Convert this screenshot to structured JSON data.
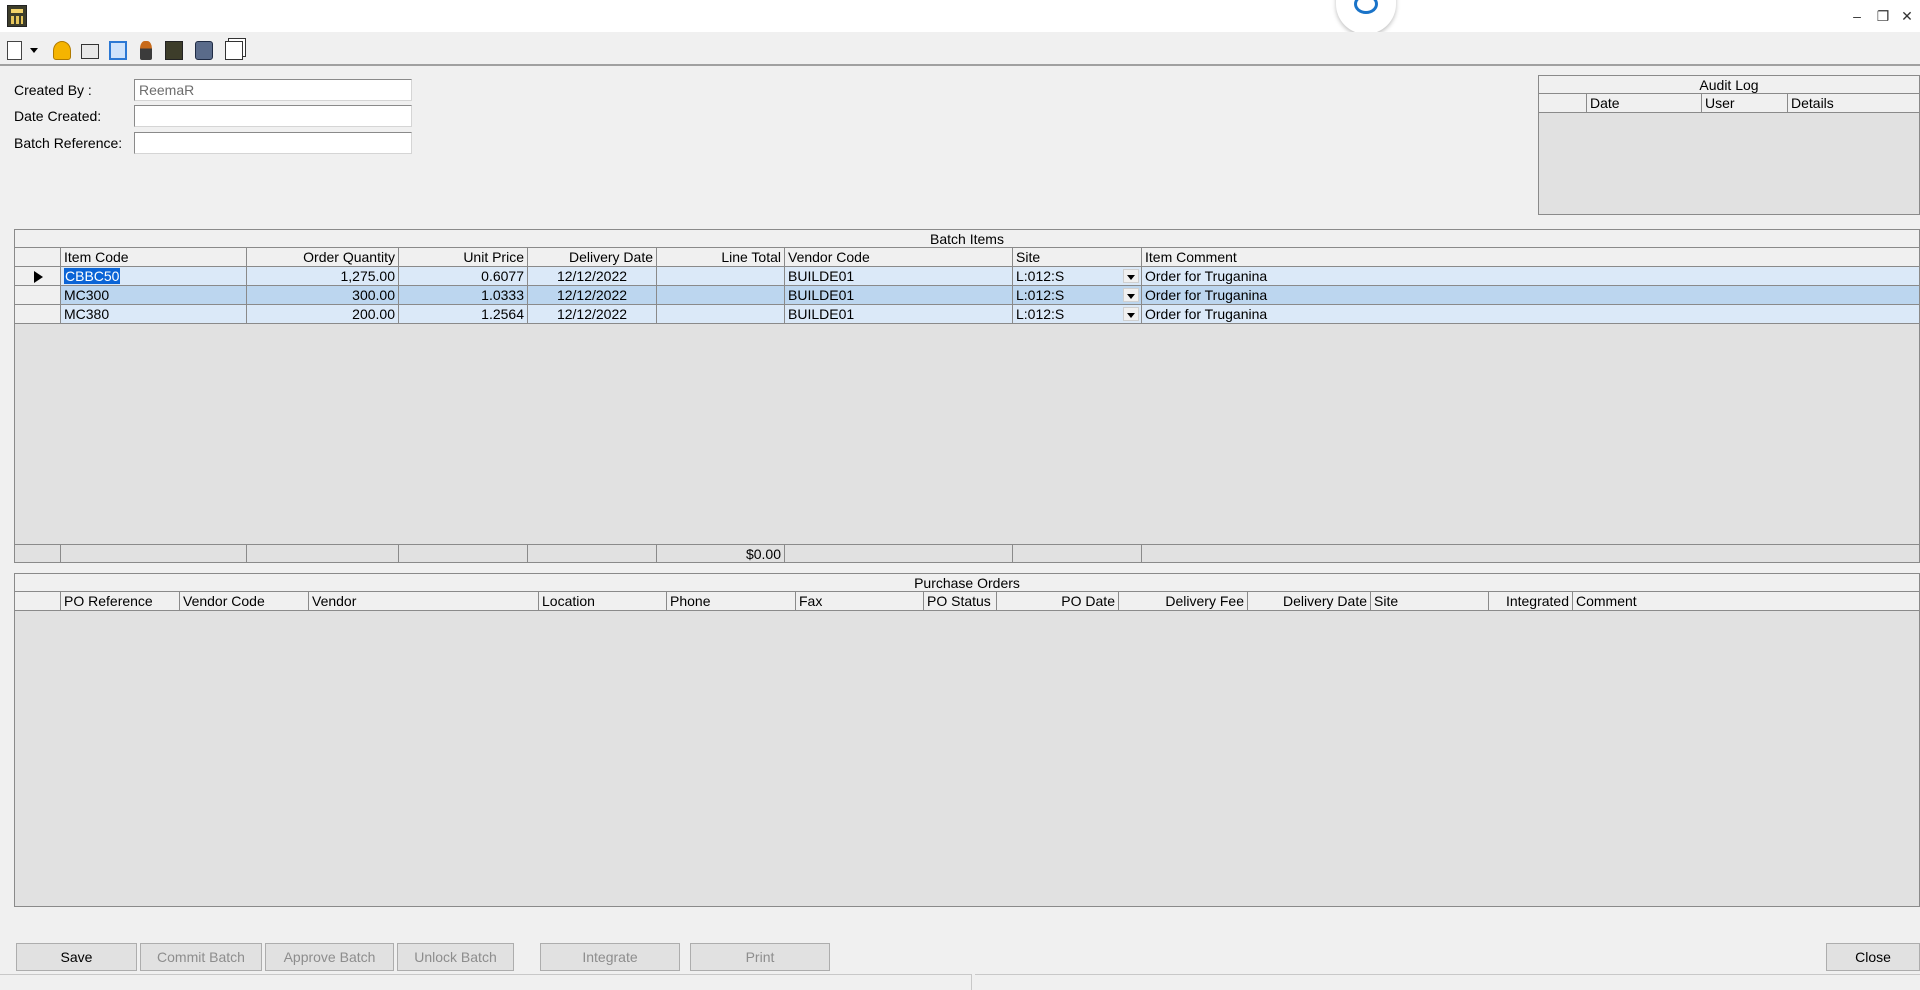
{
  "window": {
    "minimize": "–",
    "restore": "❐",
    "close": "✕"
  },
  "toolbar": {
    "icons": [
      "new-document-icon",
      "dropdown-arrow-icon",
      "lock-icon",
      "folder-icon",
      "copy-icon",
      "user-icon",
      "calculator-icon",
      "cube-icon",
      "window-icon"
    ]
  },
  "form": {
    "created_by_label": "Created By :",
    "created_by_value": "ReemaR",
    "date_created_label": "Date Created:",
    "date_created_value": "",
    "batch_reference_label": "Batch Reference:",
    "batch_reference_value": ""
  },
  "audit_log": {
    "title": "Audit Log",
    "columns": [
      "Date",
      "User",
      "Details"
    ]
  },
  "batch_items": {
    "title": "Batch Items",
    "columns": [
      "Item Code",
      "Order Quantity",
      "Unit Price",
      "Delivery Date",
      "Line Total",
      "Vendor Code",
      "Site",
      "Item Comment"
    ],
    "rows": [
      {
        "item_code": "CBBC50",
        "order_quantity": "1,275.00",
        "unit_price": "0.6077",
        "delivery_date": "12/12/2022",
        "line_total": "",
        "vendor_code": "BUILDE01",
        "site": "L:012:S",
        "item_comment": "Order for Truganina"
      },
      {
        "item_code": "MC300",
        "order_quantity": "300.00",
        "unit_price": "1.0333",
        "delivery_date": "12/12/2022",
        "line_total": "",
        "vendor_code": "BUILDE01",
        "site": "L:012:S",
        "item_comment": "Order for Truganina"
      },
      {
        "item_code": "MC380",
        "order_quantity": "200.00",
        "unit_price": "1.2564",
        "delivery_date": "12/12/2022",
        "line_total": "",
        "vendor_code": "BUILDE01",
        "site": "L:012:S",
        "item_comment": "Order for Truganina"
      }
    ],
    "total_line_total": "$0.00"
  },
  "purchase_orders": {
    "title": "Purchase Orders",
    "columns": [
      "PO Reference",
      "Vendor Code",
      "Vendor",
      "Location",
      "Phone",
      "Fax",
      "PO Status",
      "PO Date",
      "Delivery Fee",
      "Delivery Date",
      "Site",
      "Integrated",
      "Comment"
    ]
  },
  "buttons": {
    "save": "Save",
    "commit_batch": "Commit Batch",
    "approve_batch": "Approve Batch",
    "unlock_batch": "Unlock Batch",
    "integrate": "Integrate",
    "print": "Print",
    "close": "Close"
  }
}
